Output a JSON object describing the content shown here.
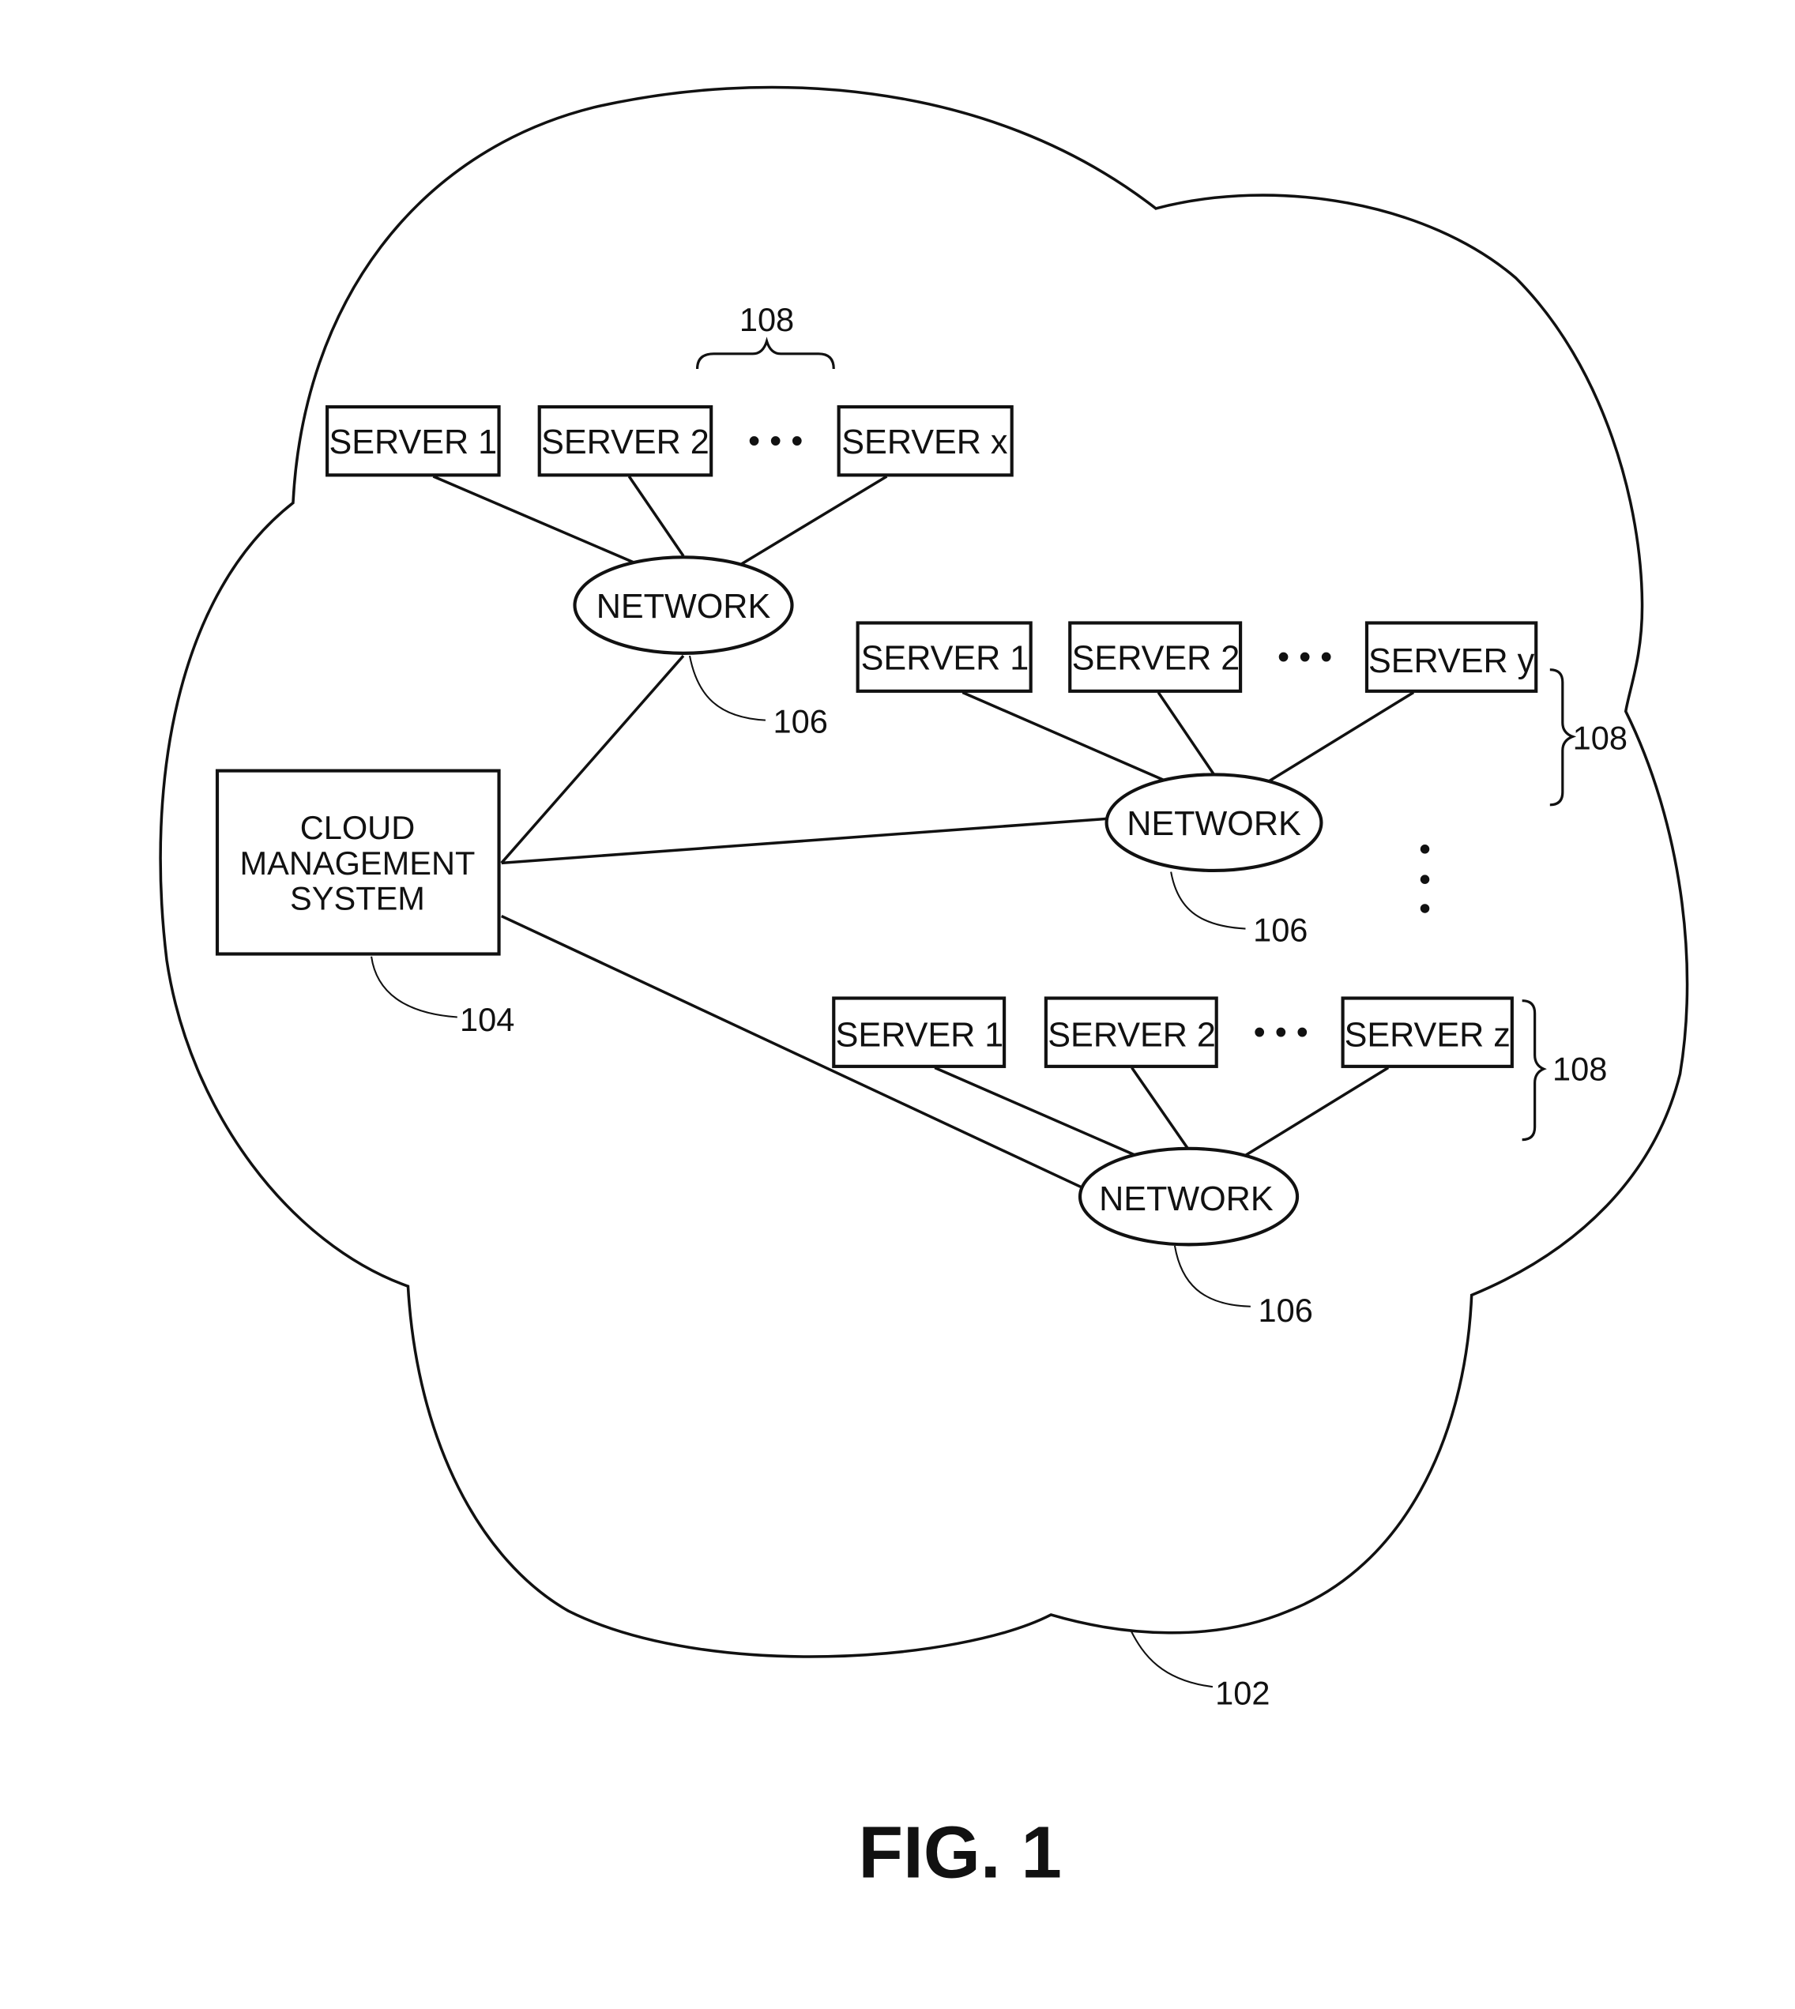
{
  "figure": {
    "caption": "FIG. 1",
    "cloud": {
      "ref": "102"
    },
    "cms": {
      "lines": [
        "CLOUD",
        "MANAGEMENT",
        "SYSTEM"
      ],
      "ref": "104"
    },
    "clusters": [
      {
        "servers": [
          "SERVER 1",
          "SERVER 2",
          "SERVER x"
        ],
        "ellipsis": "• • •",
        "network_label": "NETWORK",
        "network_ref": "106",
        "group_ref": "108"
      },
      {
        "servers": [
          "SERVER 1",
          "SERVER 2",
          "SERVER y"
        ],
        "ellipsis": "• • •",
        "network_label": "NETWORK",
        "network_ref": "106",
        "group_ref": "108"
      },
      {
        "servers": [
          "SERVER 1",
          "SERVER 2",
          "SERVER z"
        ],
        "ellipsis": "• • •",
        "network_label": "NETWORK",
        "network_ref": "106",
        "group_ref": "108"
      }
    ],
    "vertical_ellipsis": "⋮"
  }
}
